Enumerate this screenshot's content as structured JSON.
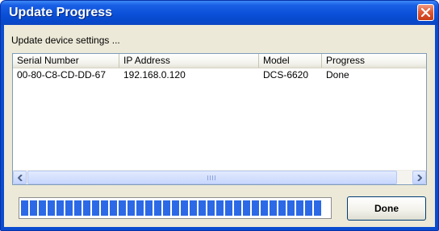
{
  "window": {
    "title": "Update Progress",
    "caption": "Update device settings ...",
    "colors": {
      "titlebar": "#0a50d8",
      "client": "#ece9d8",
      "progress": "#2c69e6",
      "close": "#e05a36"
    }
  },
  "table": {
    "columns": [
      "Serial Number",
      "IP Address",
      "Model",
      "Progress"
    ],
    "rows": [
      [
        "00-80-C8-CD-DD-67",
        "192.168.0.120",
        "DCS-6620",
        "Done"
      ]
    ]
  },
  "progress": {
    "fraction": 0.98
  },
  "buttons": {
    "done_label": "Done"
  },
  "icons": {
    "close": "close-icon",
    "scroll_left": "arrow-left-icon",
    "scroll_right": "arrow-right-icon"
  }
}
